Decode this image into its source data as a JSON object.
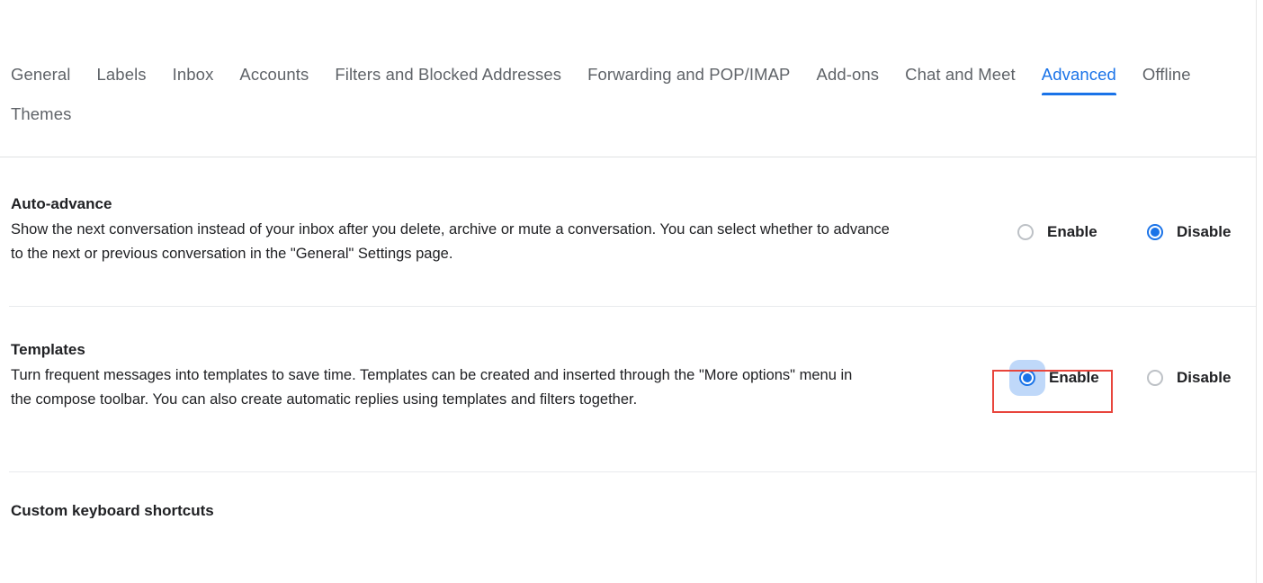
{
  "tabs": [
    {
      "label": "General",
      "active": false
    },
    {
      "label": "Labels",
      "active": false
    },
    {
      "label": "Inbox",
      "active": false
    },
    {
      "label": "Accounts",
      "active": false
    },
    {
      "label": "Filters and Blocked Addresses",
      "active": false
    },
    {
      "label": "Forwarding and POP/IMAP",
      "active": false
    },
    {
      "label": "Add-ons",
      "active": false
    },
    {
      "label": "Chat and Meet",
      "active": false
    },
    {
      "label": "Advanced",
      "active": true
    },
    {
      "label": "Offline",
      "active": false
    },
    {
      "label": "Themes",
      "active": false
    }
  ],
  "settings": {
    "auto_advance": {
      "title": "Auto-advance",
      "description": "Show the next conversation instead of your inbox after you delete, archive or mute a conversation. You can select whether to advance to the next or previous conversation in the \"General\" Settings page.",
      "enable_label": "Enable",
      "disable_label": "Disable",
      "selected": "Disable"
    },
    "templates": {
      "title": "Templates",
      "description": "Turn frequent messages into templates to save time. Templates can be created and inserted through the \"More options\" menu in the compose toolbar. You can also create automatic replies using templates and filters together.",
      "enable_label": "Enable",
      "disable_label": "Disable",
      "selected": "Enable"
    },
    "custom_keyboard_shortcuts": {
      "title": "Custom keyboard shortcuts"
    }
  },
  "colors": {
    "accent_blue": "#1a73e8",
    "text_primary": "#202124",
    "text_secondary": "#5f6368",
    "divider": "#e8eaed",
    "annotation_red": "#e8453c",
    "radio_unselected": "#bdc1c6"
  }
}
